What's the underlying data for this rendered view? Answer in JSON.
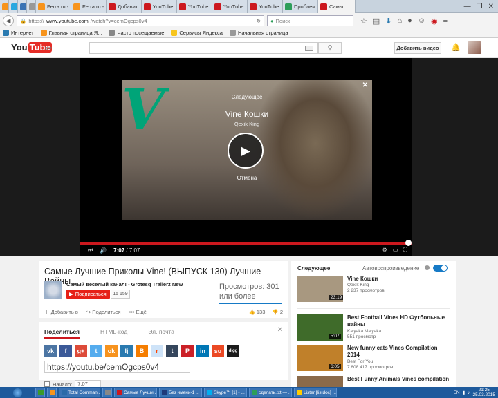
{
  "browser": {
    "tabs": [
      {
        "label": "",
        "color": "#f7941d"
      },
      {
        "label": "",
        "color": "#29a8e0"
      },
      {
        "label": "",
        "color": "#3a73b4"
      },
      {
        "label": "",
        "color": "#999999"
      },
      {
        "label": "Ferra.ru -...",
        "color": "#f7941d"
      },
      {
        "label": "Ferra.ru -...",
        "color": "#f7941d"
      },
      {
        "label": "Добавит...",
        "color": "#cc181e"
      },
      {
        "label": "YouTube ...",
        "color": "#cc181e"
      },
      {
        "label": "YouTube ...",
        "color": "#cc181e"
      },
      {
        "label": "YouTube ...",
        "color": "#cc181e"
      },
      {
        "label": "YouTube ...",
        "color": "#cc181e"
      },
      {
        "label": "Проблем...",
        "color": "#2d9e5a"
      },
      {
        "label": "Самы",
        "color": "#cc181e",
        "active": true
      }
    ],
    "url_prefix": "https://",
    "url_host": "www.youtube.com",
    "url_path": "/watch?v=cemOgcps0v4",
    "search_placeholder": "Поиск",
    "bookmarks": [
      "Интернет",
      "Главная страница Я...",
      "Часто посещаемые",
      "Сервисы Яндекса",
      "Начальная страница"
    ]
  },
  "youtube": {
    "logo_you": "You",
    "logo_tube": "Tube",
    "upload_label": "Добавить видео",
    "endcard": {
      "next_label": "Следующее",
      "title": "Vine Кошки",
      "channel": "Qexik King",
      "cancel_label": "Отмена"
    },
    "player": {
      "current_time": "7:07",
      "duration": "/ 7:07",
      "progress": 1.0
    },
    "video": {
      "title": "Самые Лучшие Приколы Vine! (ВЫПУСК 130) Лучшие Вайны",
      "channel": "Самый весёлый канал! - Grotesq Trailerz New",
      "subscribe_label": "Подписаться",
      "subscriber_count": "15 159",
      "views": "Просмотров: 301 или более",
      "add_label": "Добавить в",
      "share_label": "Поделиться",
      "more_label": "Ещё",
      "likes": "133",
      "dislikes": "2"
    },
    "share": {
      "tabs": [
        "Поделиться",
        "HTML-код",
        "Эл. почта"
      ],
      "link": "https://youtu.be/cemOgcps0v4",
      "start_label": "Начало:",
      "start_time": "7:07",
      "socials": [
        {
          "name": "vk",
          "color": "#4c75a3",
          "glyph": "vk"
        },
        {
          "name": "facebook",
          "color": "#3b5998",
          "glyph": "f"
        },
        {
          "name": "google-plus",
          "color": "#dd4b39",
          "glyph": "g+"
        },
        {
          "name": "twitter",
          "color": "#55acee",
          "glyph": "t"
        },
        {
          "name": "odnoklassniki",
          "color": "#f7931e",
          "glyph": "ok"
        },
        {
          "name": "livejournal",
          "color": "#2a7ab0",
          "glyph": "lj"
        },
        {
          "name": "blogger",
          "color": "#f57d00",
          "glyph": "B"
        },
        {
          "name": "reddit",
          "color": "#cee3f8",
          "glyph": "r"
        },
        {
          "name": "tumblr",
          "color": "#35465c",
          "glyph": "t"
        },
        {
          "name": "pinterest",
          "color": "#cb2027",
          "glyph": "P"
        },
        {
          "name": "linkedin",
          "color": "#0077b5",
          "glyph": "in"
        },
        {
          "name": "stumbleupon",
          "color": "#eb4924",
          "glyph": "su"
        },
        {
          "name": "digg",
          "color": "#1b1b1b",
          "glyph": "digg"
        }
      ]
    },
    "sidebar": {
      "heading": "Следующее",
      "autoplay_label": "Автовоспроизведение",
      "items": [
        {
          "title": "Vine Кошки",
          "channel": "Qexik King",
          "views": "2 237 просмотров",
          "duration": "23:19",
          "thumb": "#a89880"
        },
        {
          "title": "Best Football Vines HD Футбольные вайны",
          "channel": "Kalyaka Malyaka",
          "views": "551 просмотр",
          "duration": "5:07",
          "thumb": "#3f6b2a"
        },
        {
          "title": "New funny cats Vines Compilation 2014",
          "channel": "Best For You",
          "views": "7 808 417 просмотров",
          "duration": "6:05",
          "thumb": "#c0802a"
        },
        {
          "title": "Best Funny Animals Vines compilation",
          "channel": "",
          "views": "",
          "duration": "",
          "thumb": "#8a6a4a"
        }
      ]
    }
  },
  "taskbar": {
    "items": [
      {
        "label": "",
        "color": "#3a9a2a"
      },
      {
        "label": "",
        "color": "#f7941d"
      },
      {
        "label": "Total Comman...",
        "color": "#2a6aa8"
      },
      {
        "label": "",
        "color": "#888888"
      },
      {
        "label": "Самые Лучши...",
        "color": "#cc181e"
      },
      {
        "label": "Без имени-1 ...",
        "color": "#1f3a7a"
      },
      {
        "label": "Skype™ [1] - ...",
        "color": "#00aff0"
      },
      {
        "label": "сделать.txt — ...",
        "color": "#2d9e5a"
      },
      {
        "label": "Lister [listdoc] ...",
        "color": "#ffcc00"
      }
    ],
    "lang": "EN",
    "time": "21:25",
    "date": "25.03.2015"
  }
}
